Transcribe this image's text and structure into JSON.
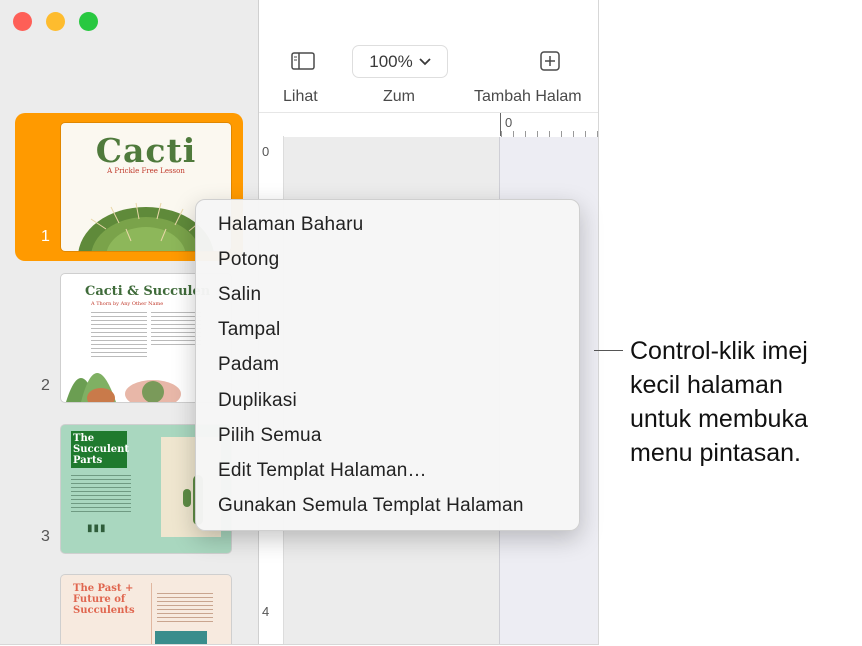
{
  "toolbar": {
    "view_label": "Lihat",
    "zoom_value": "100%",
    "zoom_label": "Zum",
    "add_page_label": "Tambah Halam"
  },
  "rulers": {
    "h_zero": "0",
    "v_zero": "0",
    "v_four": "4"
  },
  "pages": [
    {
      "number": "1",
      "title": "Cacti",
      "subtitle": "A Prickle Free Lesson"
    },
    {
      "number": "2",
      "title": "Cacti & Succulen",
      "subtitle": "A Thorn by Any Other Name"
    },
    {
      "number": "3",
      "title": "The Succulent Parts"
    },
    {
      "number": "",
      "title": "The Past + Future of Succulents"
    }
  ],
  "context_menu": {
    "items": [
      "Halaman Baharu",
      "Potong",
      "Salin",
      "Tampal",
      "Padam",
      "Duplikasi",
      "Pilih Semua",
      "Edit Templat Halaman…",
      "Gunakan Semula Templat Halaman"
    ]
  },
  "callout": {
    "lines": [
      "Control-klik imej",
      "kecil halaman",
      "untuk membuka",
      "menu pintasan."
    ]
  },
  "colors": {
    "selection": "#ff9a00",
    "cactus_green": "#4f7a3c",
    "page3_bg": "#a9d7bf"
  }
}
